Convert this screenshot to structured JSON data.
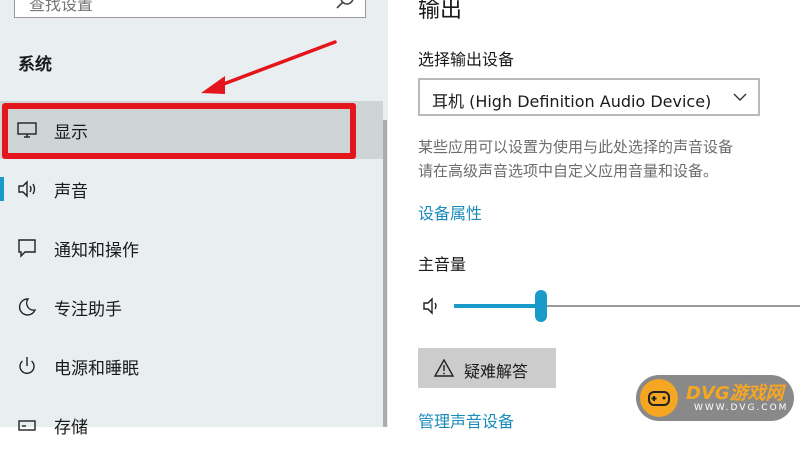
{
  "sidebar": {
    "search_placeholder": "查找设置",
    "section_title": "系统",
    "items": [
      {
        "label": "显示",
        "icon": "monitor-icon",
        "selected": true
      },
      {
        "label": "声音",
        "icon": "speaker-icon",
        "selected": false
      },
      {
        "label": "通知和操作",
        "icon": "notification-icon",
        "selected": false
      },
      {
        "label": "专注助手",
        "icon": "moon-icon",
        "selected": false
      },
      {
        "label": "电源和睡眠",
        "icon": "power-icon",
        "selected": false
      },
      {
        "label": "存储",
        "icon": "storage-icon",
        "selected": false
      }
    ]
  },
  "main": {
    "title": "输出",
    "output_device_label": "选择输出设备",
    "output_device_value": "耳机 (High Definition Audio Device)",
    "help_text_line1": "某些应用可以设置为使用与此处选择的声音设备",
    "help_text_line2": "请在高级声音选项中自定义应用音量和设备。",
    "device_properties_link": "设备属性",
    "master_volume_label": "主音量",
    "master_volume_fraction": 0.25,
    "troubleshoot_label": "疑难解答",
    "manage_devices_link": "管理声音设备"
  },
  "watermark": {
    "title": "DVG游戏网",
    "subtitle": "WWW.DVG.COM"
  },
  "colors": {
    "accent": "#1a9ac9",
    "highlight": "#e3161c",
    "link": "#1a8bb9"
  }
}
